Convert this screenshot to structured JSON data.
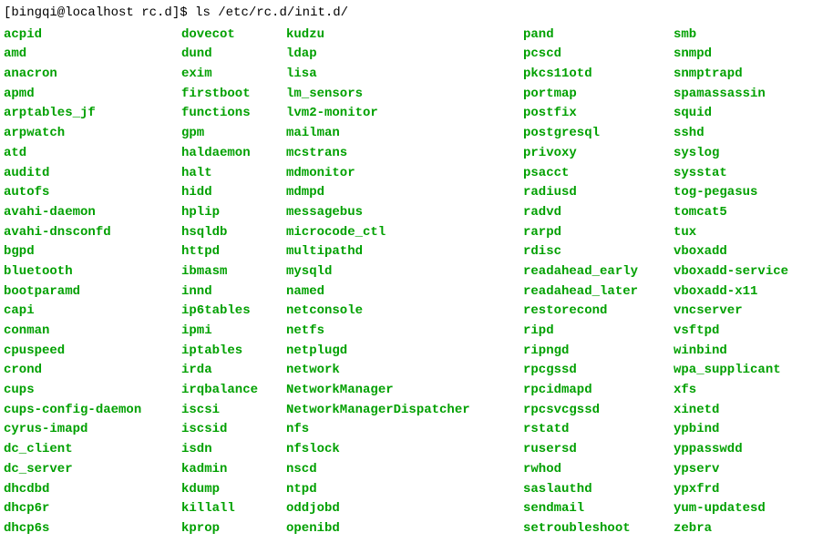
{
  "prompt": "[bingqi@localhost rc.d]$ ",
  "command": "ls /etc/rc.d/init.d/",
  "columns": [
    [
      "acpid",
      "amd",
      "anacron",
      "apmd",
      "arptables_jf",
      "arpwatch",
      "atd",
      "auditd",
      "autofs",
      "avahi-daemon",
      "avahi-dnsconfd",
      "bgpd",
      "bluetooth",
      "bootparamd",
      "capi",
      "conman",
      "cpuspeed",
      "crond",
      "cups",
      "cups-config-daemon",
      "cyrus-imapd",
      "dc_client",
      "dc_server",
      "dhcdbd",
      "dhcp6r",
      "dhcp6s"
    ],
    [
      "dovecot",
      "dund",
      "exim",
      "firstboot",
      "functions",
      "gpm",
      "haldaemon",
      "halt",
      "hidd",
      "hplip",
      "hsqldb",
      "httpd",
      "ibmasm",
      "innd",
      "ip6tables",
      "ipmi",
      "iptables",
      "irda",
      "irqbalance",
      "iscsi",
      "iscsid",
      "isdn",
      "kadmin",
      "kdump",
      "killall",
      "kprop"
    ],
    [
      "kudzu",
      "ldap",
      "lisa",
      "lm_sensors",
      "lvm2-monitor",
      "mailman",
      "mcstrans",
      "mdmonitor",
      "mdmpd",
      "messagebus",
      "microcode_ctl",
      "multipathd",
      "mysqld",
      "named",
      "netconsole",
      "netfs",
      "netplugd",
      "network",
      "NetworkManager",
      "NetworkManagerDispatcher",
      "nfs",
      "nfslock",
      "nscd",
      "ntpd",
      "oddjobd",
      "openibd"
    ],
    [
      "pand",
      "pcscd",
      "pkcs11otd",
      "portmap",
      "postfix",
      "postgresql",
      "privoxy",
      "psacct",
      "radiusd",
      "radvd",
      "rarpd",
      "rdisc",
      "readahead_early",
      "readahead_later",
      "restorecond",
      "ripd",
      "ripngd",
      "rpcgssd",
      "rpcidmapd",
      "rpcsvcgssd",
      "rstatd",
      "rusersd",
      "rwhod",
      "saslauthd",
      "sendmail",
      "setroubleshoot"
    ],
    [
      "smb",
      "snmpd",
      "snmptrapd",
      "spamassassin",
      "squid",
      "sshd",
      "syslog",
      "sysstat",
      "tog-pegasus",
      "tomcat5",
      "tux",
      "vboxadd",
      "vboxadd-service",
      "vboxadd-x11",
      "vncserver",
      "vsftpd",
      "winbind",
      "wpa_supplicant",
      "xfs",
      "xinetd",
      "ypbind",
      "yppasswdd",
      "ypserv",
      "ypxfrd",
      "yum-updatesd",
      "zebra"
    ]
  ]
}
